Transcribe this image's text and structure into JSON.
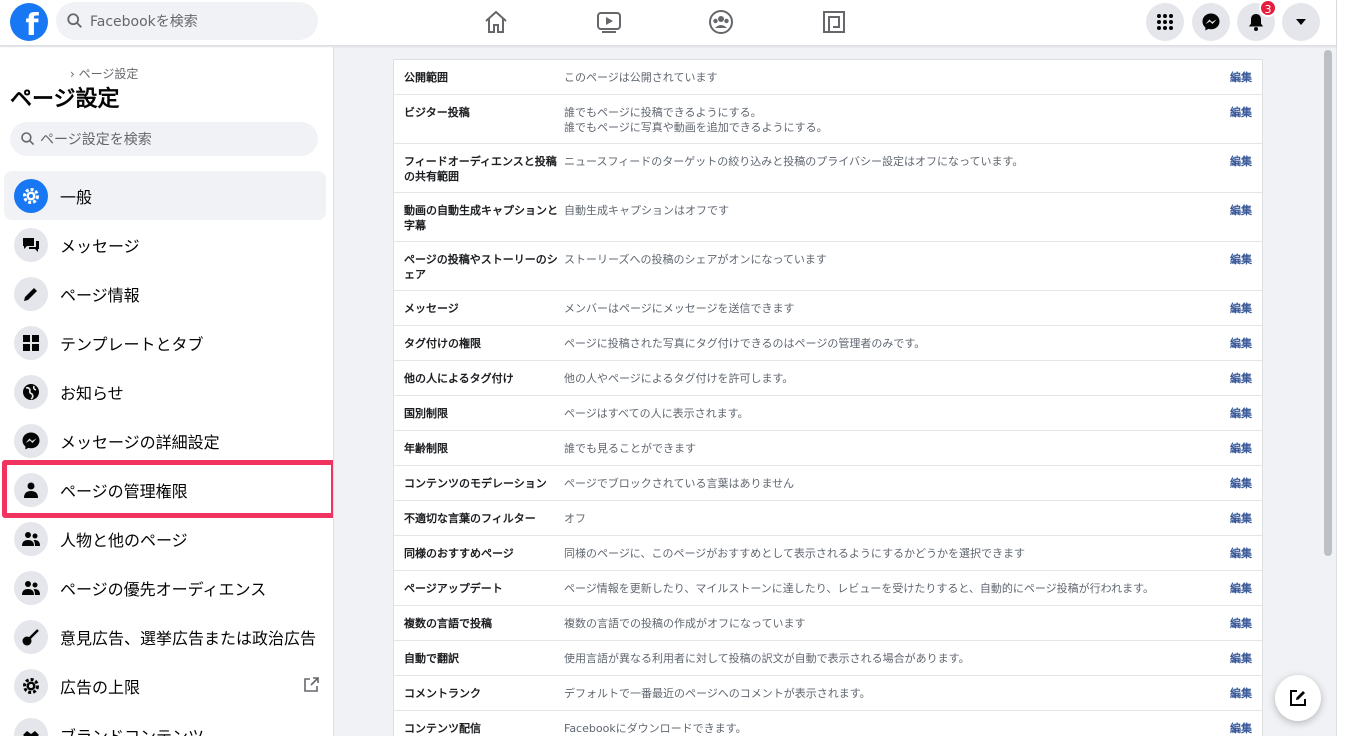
{
  "topbar": {
    "logo": "f",
    "search_placeholder": "Facebookを検索",
    "notifications_count": "3"
  },
  "sidebar": {
    "breadcrumb": "› ページ設定",
    "title": "ページ設定",
    "search_placeholder": "ページ設定を検索",
    "items": [
      {
        "label": "一般",
        "icon": "gear-icon",
        "active": true
      },
      {
        "label": "メッセージ",
        "icon": "chat-icon"
      },
      {
        "label": "ページ情報",
        "icon": "pencil-icon"
      },
      {
        "label": "テンプレートとタブ",
        "icon": "grid-icon"
      },
      {
        "label": "お知らせ",
        "icon": "globe-icon"
      },
      {
        "label": "メッセージの詳細設定",
        "icon": "messenger-icon"
      },
      {
        "label": "ページの管理権限",
        "icon": "person-icon",
        "highlighted": true
      },
      {
        "label": "人物と他のページ",
        "icon": "people-icon"
      },
      {
        "label": "ページの優先オーディエンス",
        "icon": "people-icon"
      },
      {
        "label": "意見広告、選挙広告または政治広告",
        "icon": "guitar-icon"
      },
      {
        "label": "広告の上限",
        "icon": "gear-icon",
        "external": true
      },
      {
        "label": "ブランドコンテンツ",
        "icon": "handshake-icon"
      }
    ]
  },
  "settings": {
    "edit_label": "編集",
    "rows": [
      {
        "key": "公開範囲",
        "value": "このページは公開されています"
      },
      {
        "key": "ビジター投稿",
        "value": "誰でもページに投稿できるようにする。\n誰でもページに写真や動画を追加できるようにする。"
      },
      {
        "key": "フィードオーディエンスと投稿の共有範囲",
        "value": "ニュースフィードのターゲットの絞り込みと投稿のプライバシー設定はオフになっています。"
      },
      {
        "key": "動画の自動生成キャプションと字幕",
        "value": "自動生成キャプションはオフです"
      },
      {
        "key": "ページの投稿やストーリーのシェア",
        "value": "ストーリーズへの投稿のシェアがオンになっています"
      },
      {
        "key": "メッセージ",
        "value": "メンバーはページにメッセージを送信できます"
      },
      {
        "key": "タグ付けの権限",
        "value": "ページに投稿された写真にタグ付けできるのはページの管理者のみです。"
      },
      {
        "key": "他の人によるタグ付け",
        "value": "他の人やページによるタグ付けを許可します。"
      },
      {
        "key": "国別制限",
        "value": "ページはすべての人に表示されます。"
      },
      {
        "key": "年齢制限",
        "value": "誰でも見ることができます"
      },
      {
        "key": "コンテンツのモデレーション",
        "value": "ページでブロックされている言葉はありません"
      },
      {
        "key": "不適切な言葉のフィルター",
        "value": "オフ"
      },
      {
        "key": "同様のおすすめページ",
        "value": "同様のページに、このページがおすすめとして表示されるようにするかどうかを選択できます"
      },
      {
        "key": "ページアップデート",
        "value": "ページ情報を更新したり、マイルストーンに達したり、レビューを受けたりすると、自動的にページ投稿が行われます。"
      },
      {
        "key": "複数の言語で投稿",
        "value": "複数の言語での投稿の作成がオフになっています"
      },
      {
        "key": "自動で翻訳",
        "value": "使用言語が異なる利用者に対して投稿の訳文が自動で表示される場合があります。"
      },
      {
        "key": "コメントランク",
        "value": "デフォルトで一番最近のページへのコメントが表示されます。"
      },
      {
        "key": "コンテンツ配信",
        "value": "Facebookにダウンロードできます。"
      }
    ]
  },
  "colors": {
    "brand": "#1877f2",
    "link": "#385898",
    "highlight": "#f0345f"
  }
}
